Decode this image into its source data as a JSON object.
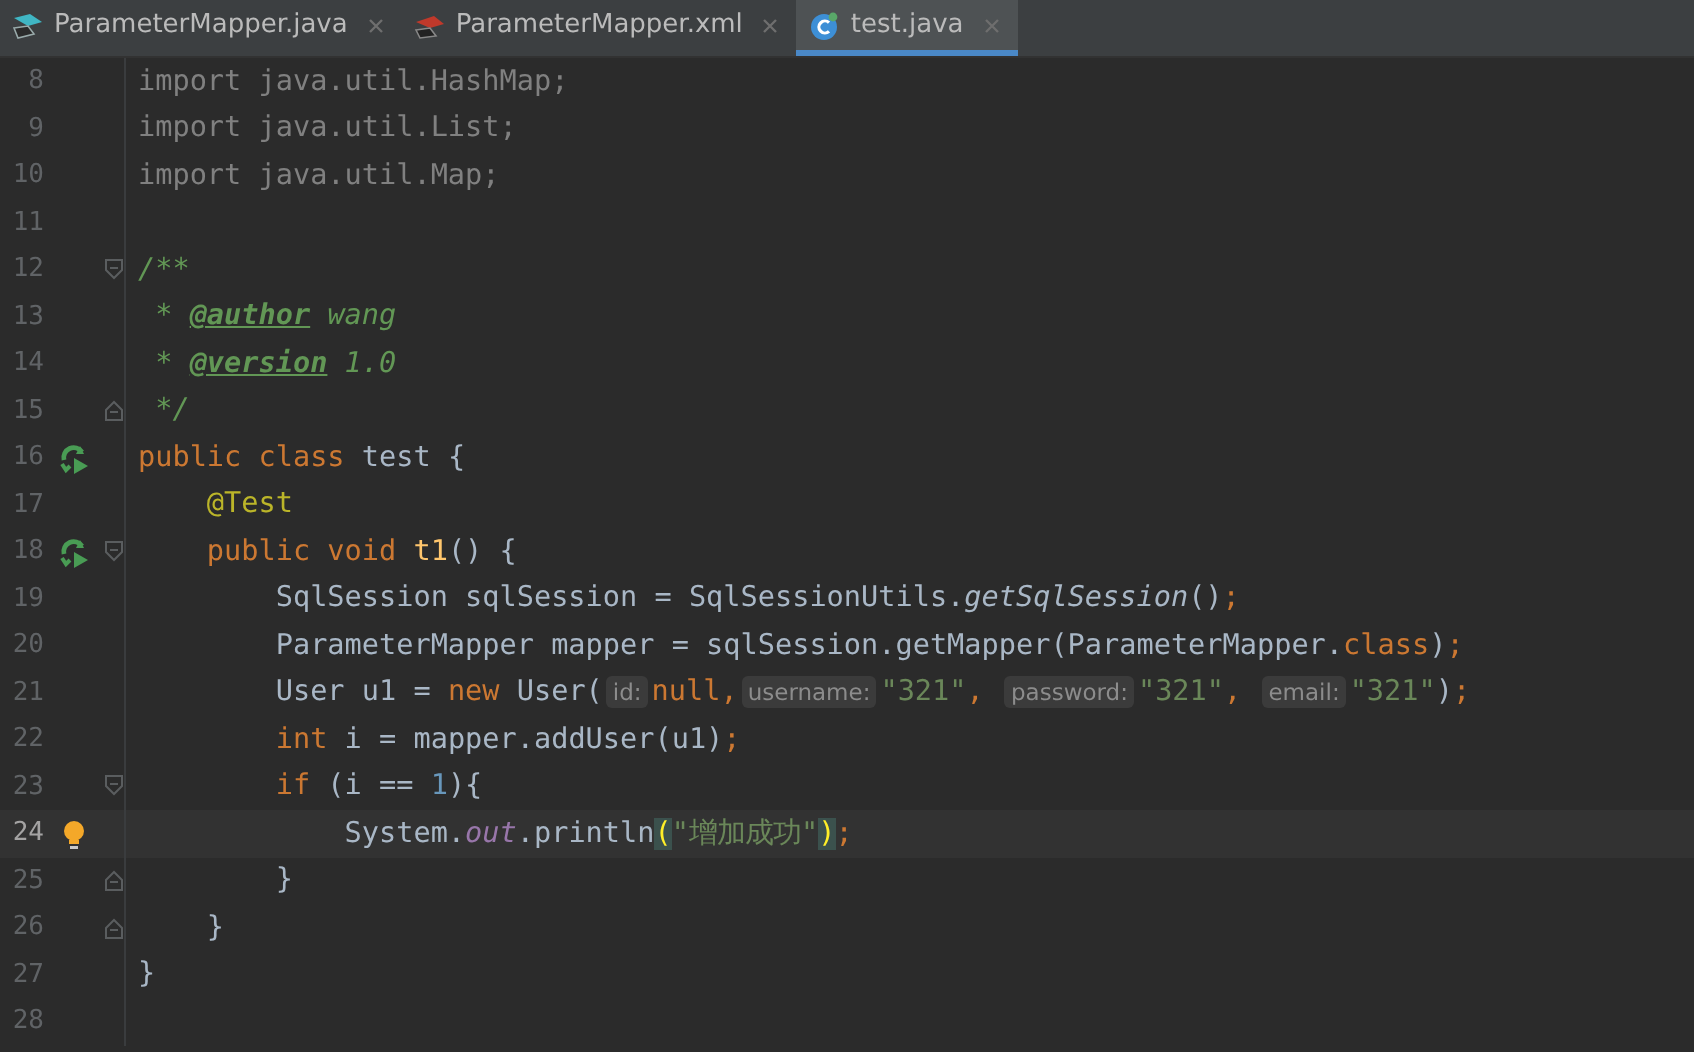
{
  "tabs": [
    {
      "label": "ParameterMapper.java",
      "kind": "java",
      "selected": false
    },
    {
      "label": "ParameterMapper.xml",
      "kind": "xml",
      "selected": false
    },
    {
      "label": "test.java",
      "kind": "class",
      "selected": true
    }
  ],
  "editor": {
    "lines": [
      {
        "number": "8",
        "tokens": [
          {
            "t": "import java.util.HashMap;",
            "kind": "unused"
          }
        ]
      },
      {
        "number": "9",
        "tokens": [
          {
            "t": "import java.util.List;",
            "kind": "unused"
          }
        ]
      },
      {
        "number": "10",
        "tokens": [
          {
            "t": "import java.util.Map;",
            "kind": "unused"
          }
        ]
      },
      {
        "number": "11"
      },
      {
        "number": "12",
        "fold_start": true,
        "tokens": [
          {
            "t": "/**",
            "kind": "doc"
          }
        ]
      },
      {
        "number": "13",
        "tokens": [
          {
            "t": " * ",
            "kind": "doc"
          },
          {
            "t": "@author",
            "kind": "doctag"
          },
          {
            "t": " wang",
            "kind": "doc"
          }
        ]
      },
      {
        "number": "14",
        "tokens": [
          {
            "t": " * ",
            "kind": "doc"
          },
          {
            "t": "@version",
            "kind": "doctag"
          },
          {
            "t": " 1.0",
            "kind": "doc"
          }
        ]
      },
      {
        "number": "15",
        "fold_end": true,
        "tokens": [
          {
            "t": " */",
            "kind": "doc"
          }
        ]
      },
      {
        "number": "16",
        "run": true,
        "tokens": [
          {
            "t": "public class",
            "kind": "keyword"
          },
          {
            "t": " test {",
            "kind": "plain"
          }
        ]
      },
      {
        "number": "17",
        "tokens": [
          {
            "t": "    @Test",
            "kind": "annotation"
          }
        ]
      },
      {
        "number": "18",
        "run": true,
        "fold_start": true,
        "tokens": [
          {
            "t": "    public void ",
            "kind": "keyword"
          },
          {
            "t": "t1",
            "kind": "declaration"
          },
          {
            "t": "() {",
            "kind": "plain"
          }
        ]
      },
      {
        "number": "19",
        "tokens": [
          {
            "t": "        SqlSession sqlSession = SqlSessionUtils.",
            "kind": "plain"
          },
          {
            "t": "getSqlSession",
            "kind": "static"
          },
          {
            "t": "()",
            "kind": "plain"
          },
          {
            "t": ";",
            "kind": "keyword"
          }
        ]
      },
      {
        "number": "20",
        "tokens": [
          {
            "t": "        ParameterMapper mapper = sqlSession.getMapper(ParameterMapper.",
            "kind": "plain"
          },
          {
            "t": "class",
            "kind": "keyword"
          },
          {
            "t": ")",
            "kind": "plain"
          },
          {
            "t": ";",
            "kind": "keyword"
          }
        ]
      },
      {
        "number": "21",
        "tokens": [
          {
            "t": "        User u1 = ",
            "kind": "plain"
          },
          {
            "t": "new",
            "kind": "keyword"
          },
          {
            "t": " User(",
            "kind": "plain"
          },
          {
            "t": "id:",
            "kind": "hint"
          },
          {
            "t": "null,",
            "kind": "keyword"
          },
          {
            "t": "username:",
            "kind": "hint"
          },
          {
            "t": "\"321\"",
            "kind": "string"
          },
          {
            "t": ", ",
            "kind": "keyword"
          },
          {
            "t": "password:",
            "kind": "hint"
          },
          {
            "t": "\"321\"",
            "kind": "string"
          },
          {
            "t": ", ",
            "kind": "keyword"
          },
          {
            "t": "email:",
            "kind": "hint"
          },
          {
            "t": "\"321\"",
            "kind": "string"
          },
          {
            "t": ")",
            "kind": "plain"
          },
          {
            "t": ";",
            "kind": "keyword"
          }
        ]
      },
      {
        "number": "22",
        "tokens": [
          {
            "t": "        int",
            "kind": "keyword"
          },
          {
            "t": " i = mapper.addUser(u1)",
            "kind": "plain"
          },
          {
            "t": ";",
            "kind": "keyword"
          }
        ]
      },
      {
        "number": "23",
        "fold_start": true,
        "tokens": [
          {
            "t": "        if",
            "kind": "keyword"
          },
          {
            "t": " (i == ",
            "kind": "plain"
          },
          {
            "t": "1",
            "kind": "number"
          },
          {
            "t": "){",
            "kind": "plain"
          }
        ]
      },
      {
        "number": "24",
        "current": true,
        "bulb": true,
        "tokens": [
          {
            "t": "            System.",
            "kind": "plain"
          },
          {
            "t": "out",
            "kind": "field"
          },
          {
            "t": ".println",
            "kind": "plain"
          },
          {
            "t": "(",
            "kind": "match"
          },
          {
            "t": "\"增加成功\"",
            "kind": "string"
          },
          {
            "t": ")",
            "kind": "match"
          },
          {
            "t": ";",
            "kind": "keyword"
          }
        ]
      },
      {
        "number": "25",
        "fold_end": true,
        "tokens": [
          {
            "t": "        }",
            "kind": "plain"
          }
        ]
      },
      {
        "number": "26",
        "fold_end": true,
        "tokens": [
          {
            "t": "    }",
            "kind": "plain"
          }
        ]
      },
      {
        "number": "27",
        "tokens": [
          {
            "t": "}",
            "kind": "plain"
          }
        ]
      },
      {
        "number": "28"
      }
    ]
  }
}
